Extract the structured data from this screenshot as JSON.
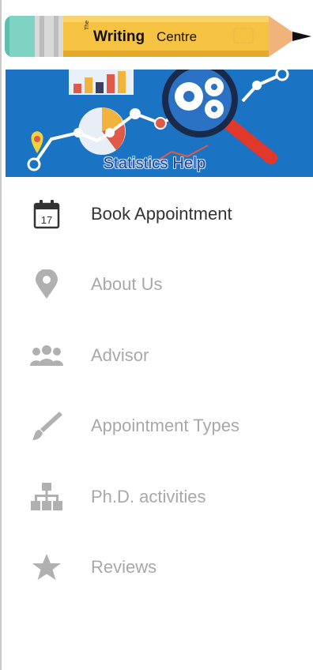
{
  "logo": {
    "prefix": "The",
    "bold": "Writing",
    "rest": "Centre"
  },
  "banner": {
    "caption": "Statistics Help"
  },
  "menu": {
    "items": [
      {
        "label": "Book Appointment",
        "icon": "calendar-icon",
        "calendar_day": "17",
        "active": true
      },
      {
        "label": "About Us",
        "icon": "location-pin-icon",
        "active": false
      },
      {
        "label": "Advisor",
        "icon": "group-people-icon",
        "active": false
      },
      {
        "label": "Appointment Types",
        "icon": "brush-icon",
        "active": false
      },
      {
        "label": "Ph.D. activities",
        "icon": "sitemap-icon",
        "active": false
      },
      {
        "label": "Reviews",
        "icon": "star-icon",
        "active": false
      }
    ]
  },
  "colors": {
    "banner_blue": "#1b73c4",
    "pencil_yellow": "#f5c242",
    "active_text": "#333333",
    "inactive_text": "#a8a8a8"
  }
}
